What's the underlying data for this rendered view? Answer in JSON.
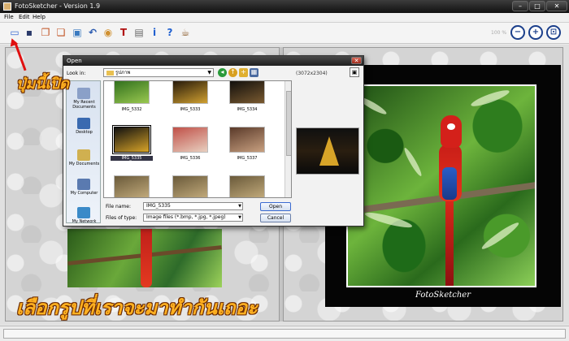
{
  "window": {
    "title": "FotoSketcher - Version 1.9"
  },
  "menu": {
    "file": "File",
    "edit": "Edit",
    "help": "Help"
  },
  "toolbar": {
    "zoom_level": "100 %",
    "tools": [
      {
        "name": "open-image-icon",
        "color": "#3a6ad0",
        "glyph": "▭"
      },
      {
        "name": "save-icon",
        "color": "#2a3a6a",
        "glyph": "▪"
      },
      {
        "name": "copy-icon",
        "color": "#c05020",
        "glyph": "❐"
      },
      {
        "name": "paste-icon",
        "color": "#c05020",
        "glyph": "❏"
      },
      {
        "name": "process-icon",
        "color": "#3a7ac0",
        "glyph": "▣"
      },
      {
        "name": "undo-icon",
        "color": "#2a5ab0",
        "glyph": "↶"
      },
      {
        "name": "palette-icon",
        "color": "#d09030",
        "glyph": "◉"
      },
      {
        "name": "text-icon",
        "color": "#b01010",
        "glyph": "T"
      },
      {
        "name": "print-icon",
        "color": "#6a6a6a",
        "glyph": "▤"
      },
      {
        "name": "info-icon",
        "color": "#2060d0",
        "glyph": "i"
      },
      {
        "name": "help-icon",
        "color": "#2060d0",
        "glyph": "?"
      },
      {
        "name": "coffee-icon",
        "color": "#8a5a2a",
        "glyph": "☕"
      }
    ],
    "zoom_buttons": [
      {
        "name": "zoom-out-icon",
        "glyph": "−"
      },
      {
        "name": "zoom-in-icon",
        "glyph": "+"
      },
      {
        "name": "zoom-fit-icon",
        "glyph": "⊡"
      }
    ]
  },
  "sketch": {
    "caption": "FotoSketcher"
  },
  "dialog": {
    "title": "Open",
    "look_in_label": "Look in:",
    "look_in_value": "รูปภาพ",
    "dimensions": "(3072x2304)",
    "places": [
      {
        "label": "My Recent Documents",
        "color": "#8aa0c8"
      },
      {
        "label": "Desktop",
        "color": "#3a6ab0"
      },
      {
        "label": "My Documents",
        "color": "#d0b050"
      },
      {
        "label": "My Computer",
        "color": "#5a7ab0"
      },
      {
        "label": "My Network",
        "color": "#3a8ac8"
      }
    ],
    "files": [
      {
        "name": "IMG_5332",
        "c1": "#2a6a1a",
        "c2": "#9ac850"
      },
      {
        "name": "IMG_5333",
        "c1": "#1a1008",
        "c2": "#d0a030"
      },
      {
        "name": "IMG_5334",
        "c1": "#0a0a0a",
        "c2": "#7a5a30"
      },
      {
        "name": "IMG_5335",
        "c1": "#101010",
        "c2": "#d8a428"
      },
      {
        "name": "IMG_5336",
        "c1": "#c05048",
        "c2": "#e8d0c0"
      },
      {
        "name": "IMG_5337",
        "c1": "#5a3a2a",
        "c2": "#c8a080"
      }
    ],
    "selected_file": "IMG_5335",
    "file_name_label": "File name:",
    "file_name_value": "IMG_5335",
    "file_type_label": "Files of type:",
    "file_type_value": "Image files (*.bmp, *.jpg, *.jpeg)",
    "open_button": "Open",
    "cancel_button": "Cancel"
  },
  "annotations": {
    "top_note": "ปุ่มนี้เปิด",
    "bottom_note": "เลือกรูปที่เราจะมาทำกันเถอะ",
    "accent_color": "#ffb020"
  }
}
